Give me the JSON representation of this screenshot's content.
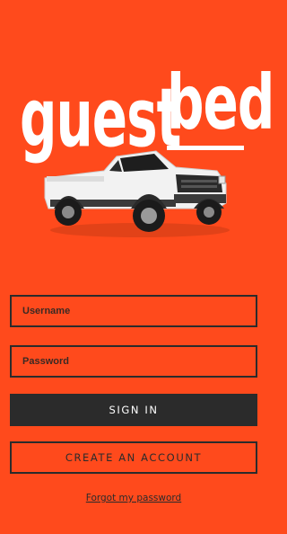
{
  "brand": {
    "logo_part1": "guest",
    "logo_part2": "bed",
    "background_color": "#ff4a1c",
    "text_color": "#ffffff",
    "dark_color": "#2b2b2b"
  },
  "hero": {
    "image": "pickup-truck-icon"
  },
  "form": {
    "username_placeholder": "Username",
    "password_placeholder": "Password"
  },
  "actions": {
    "sign_in_label": "SIGN IN",
    "create_account_label": "CREATE AN ACCOUNT",
    "forgot_password_label": "Forgot my password"
  }
}
